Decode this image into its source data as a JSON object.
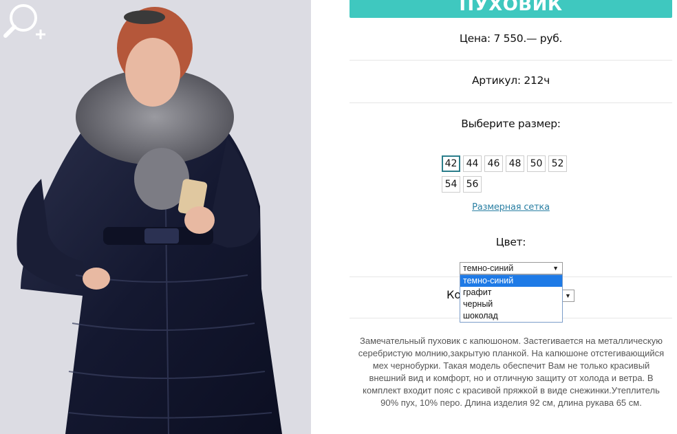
{
  "product": {
    "title": "ПУХОВИК",
    "price": "Цена: 7 550.— руб.",
    "article": "Артикул: 212ч",
    "choose_size": "Выберите размер:",
    "sizes": [
      "42",
      "44",
      "46",
      "48",
      "50",
      "52",
      "54",
      "56"
    ],
    "selected_size": "42",
    "size_chart_link": "Размерная сетка",
    "color_label": "Цвет:",
    "color_select": {
      "value": "темно-синий",
      "options": [
        "темно-синий",
        "графит",
        "черный",
        "шоколад"
      ]
    },
    "quantity_label": "Ко",
    "description": "Замечательный пуховик с капюшоном. Застегивается на металлическую серебристую молнию,закрытую планкой. На капюшоне отстегивающийся мех чернобурки. Такая модель обеспечит Вам не только красивый внешний вид и комфорт, но и отличную защиту от холода и ветра. В комплект входит пояс с красивой пряжкой в виде снежинки.Утеплитель 90% пух, 10% перо. Длина изделия 92 см, длина рукава 65 см."
  },
  "icons": {
    "zoom": "zoom-in-icon"
  },
  "colors": {
    "accent": "#3fc8bf",
    "link": "#2a7fa3",
    "dropdown_highlight": "#1e7ae6"
  }
}
